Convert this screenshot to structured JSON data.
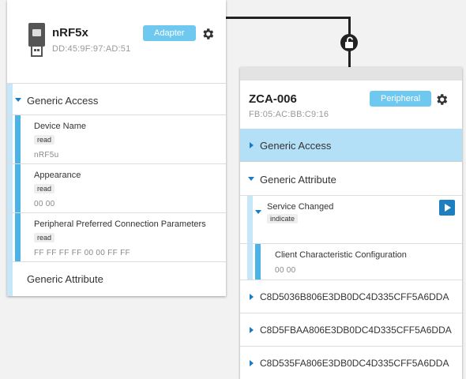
{
  "adapter": {
    "name": "nRF5x",
    "address": "DD:45:9F:97:AD:51",
    "badge": "Adapter",
    "services": [
      {
        "label": "Generic Access",
        "characteristics": [
          {
            "name": "Device Name",
            "property": "read",
            "value": "nRF5u"
          },
          {
            "name": "Appearance",
            "property": "read",
            "value": "00 00"
          },
          {
            "name": "Peripheral Preferred Connection Parameters",
            "property": "read",
            "value": "FF FF FF FF 00 00 FF FF"
          }
        ]
      },
      {
        "label": "Generic Attribute"
      }
    ]
  },
  "peripheral": {
    "name": "ZCA-006",
    "address": "FB:05:AC:BB:C9:16",
    "badge": "Peripheral",
    "services": [
      {
        "label": "Generic Access"
      },
      {
        "label": "Generic Attribute",
        "characteristics": [
          {
            "name": "Service Changed",
            "property": "indicate",
            "descriptors": [
              {
                "name": "Client Characteristic Configuration",
                "value": "00 00"
              }
            ]
          }
        ]
      },
      {
        "label": "C8D5036B806E3DB0DC4D335CFF5A6DDA"
      },
      {
        "label": "C8D5FBAA806E3DB0DC4D335CFF5A6DDA"
      },
      {
        "label": "C8D535FA806E3DB0DC4D335CFF5A6DDA"
      }
    ]
  },
  "colors": {
    "accent_blue": "#1d7fc0",
    "badge": "#6ec8ef",
    "selected_row": "#b3e0f6",
    "connector": "#222222"
  },
  "icons": [
    "usb-dongle-icon",
    "gear-icon",
    "unlock-icon",
    "caret-down-icon",
    "caret-right-icon",
    "play-icon"
  ]
}
